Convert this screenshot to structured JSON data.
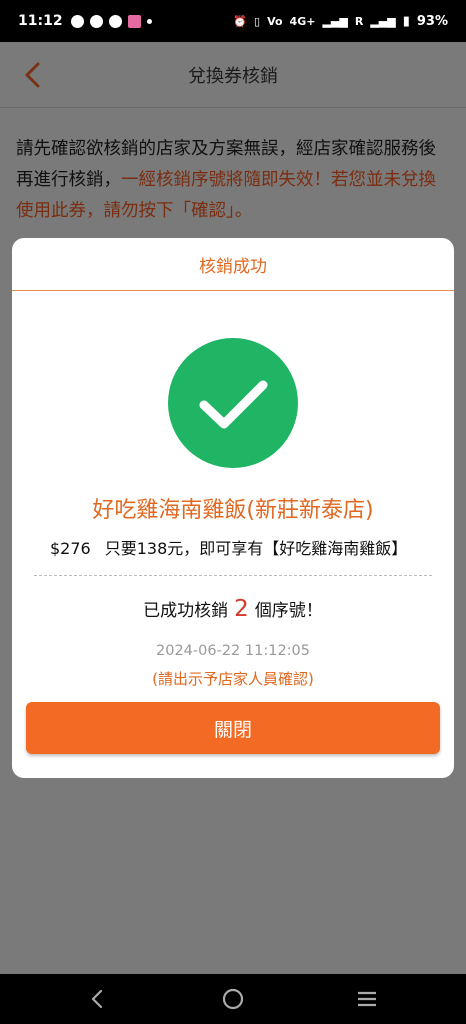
{
  "status_bar": {
    "time": "11:12",
    "network": "4G+",
    "roaming": "R",
    "battery": "93%",
    "icons": [
      "messenger-icon",
      "line-icon",
      "app-icon",
      "calendar-icon",
      "dot-icon",
      "alarm-icon",
      "vibrate-icon",
      "volte-icon",
      "signal-icon",
      "signal-icon-2",
      "battery-icon"
    ]
  },
  "header": {
    "title": "兌換券核銷"
  },
  "notice": {
    "text_part1": "請先確認欲核銷的店家及方案無誤，經店家確認服務後再進行核銷，",
    "warning": "一經核銷序號將隨即失效！若您並未兌換使用此券，請勿按下「確認」。"
  },
  "modal": {
    "title": "核銷成功",
    "store_name": "好吃雞海南雞飯(新莊新泰店)",
    "price": "$276",
    "plan": "只要138元，即可享有【好吃雞海南雞飯】",
    "success_prefix": "已成功核銷",
    "success_count": "2",
    "success_suffix": "個序號！",
    "timestamp": "2024-06-22 11:12:05",
    "hint": "(請出示予店家人員確認)",
    "close_label": "關閉"
  },
  "colors": {
    "accent": "#e06820",
    "button": "#f26a23",
    "success": "#1fb565",
    "count": "#d23a2a",
    "overlay": "#7a7a7a"
  }
}
